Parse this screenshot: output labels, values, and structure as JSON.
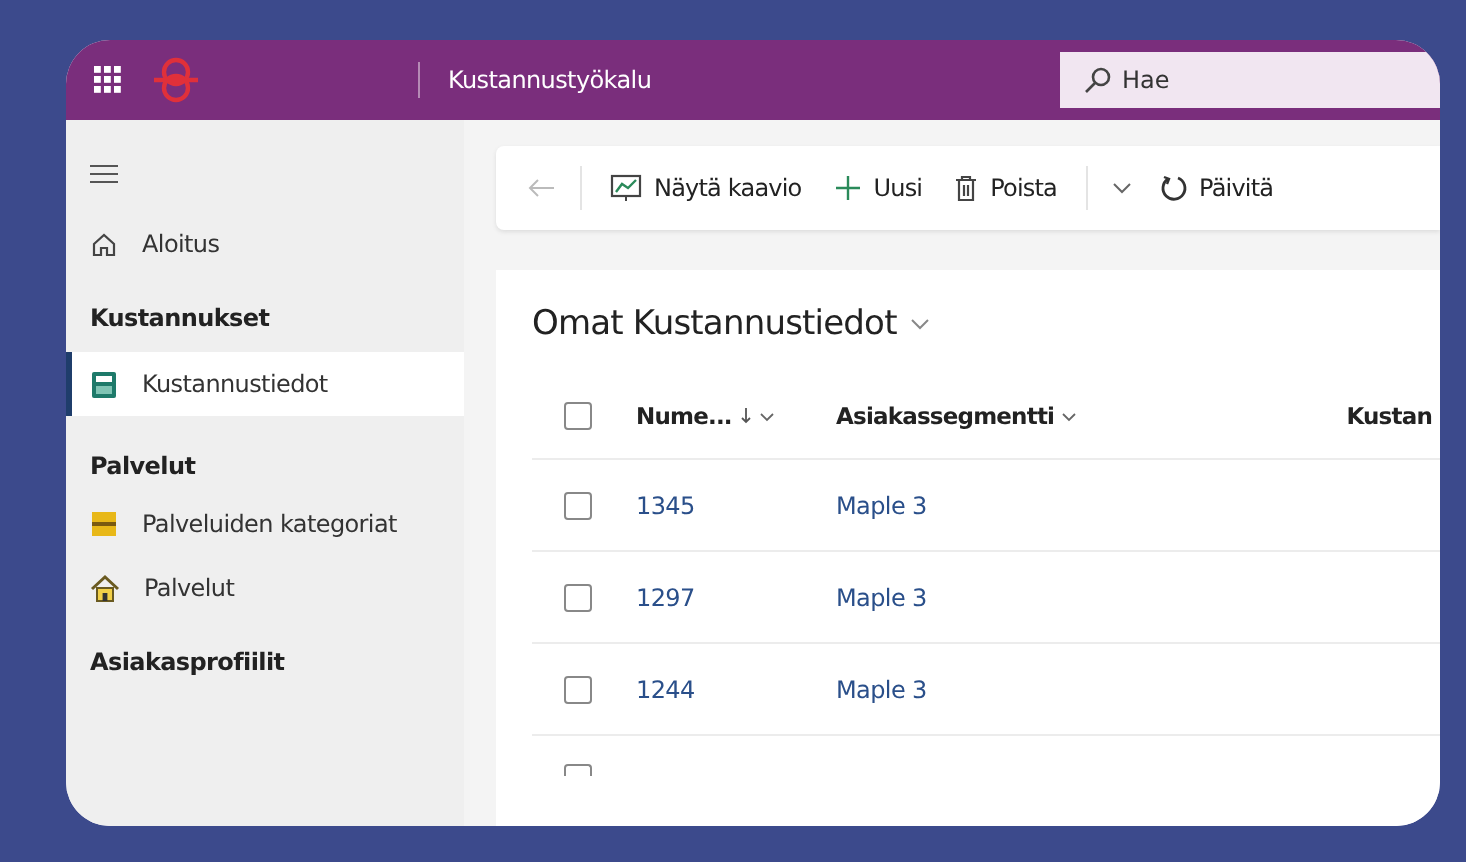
{
  "app_bar": {
    "title": "Kustannustyökalu",
    "search": {
      "placeholder": "Hae"
    }
  },
  "sidebar": {
    "items": [
      {
        "kind": "item",
        "label": "Aloitus",
        "selected": false
      },
      {
        "kind": "heading",
        "label": "Kustannukset"
      },
      {
        "kind": "item",
        "label": "Kustannustiedot",
        "selected": true
      },
      {
        "kind": "heading",
        "label": "Palvelut"
      },
      {
        "kind": "item",
        "label": "Palveluiden kategoriat",
        "selected": false
      },
      {
        "kind": "item",
        "label": "Palvelut",
        "selected": false
      },
      {
        "kind": "heading",
        "label": "Asiakasprofiilit"
      }
    ]
  },
  "toolbar": [
    {
      "kind": "chart",
      "label": "Näytä kaavio"
    },
    {
      "kind": "add",
      "label": "Uusi"
    },
    {
      "kind": "delete",
      "label": "Poista"
    },
    {
      "kind": "more"
    },
    {
      "kind": "refresh",
      "label": "Päivitä"
    }
  ],
  "view": {
    "title": "Omat Kustannustiedot",
    "all_checked": false,
    "columns": [
      {
        "label": "Nume...",
        "sorted": true
      },
      {
        "label": "Asiakassegmentti",
        "sorted": false
      },
      {
        "label": "Kustan",
        "sorted": false
      }
    ],
    "rows": [
      {
        "checked": false,
        "number": "1345",
        "segment": "Maple 3"
      },
      {
        "checked": false,
        "number": "1297",
        "segment": "Maple 3"
      },
      {
        "checked": false,
        "number": "1244",
        "segment": "Maple 3"
      }
    ]
  }
}
